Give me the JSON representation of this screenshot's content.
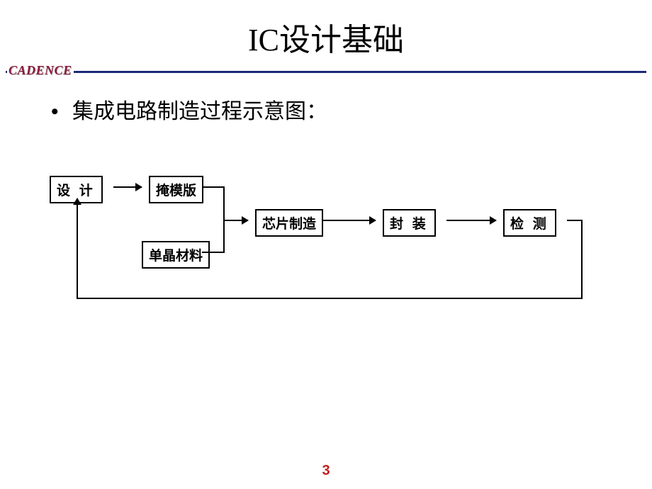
{
  "title": "IC设计基础",
  "brand": "CADENCE",
  "bullet": "集成电路制造过程示意图：",
  "nodes": {
    "design": "设 计",
    "mask": "掩模版",
    "material": "单晶材料",
    "fabrication": "芯片制造",
    "packaging": "封 装",
    "testing": "检 测"
  },
  "pageNumber": "3"
}
